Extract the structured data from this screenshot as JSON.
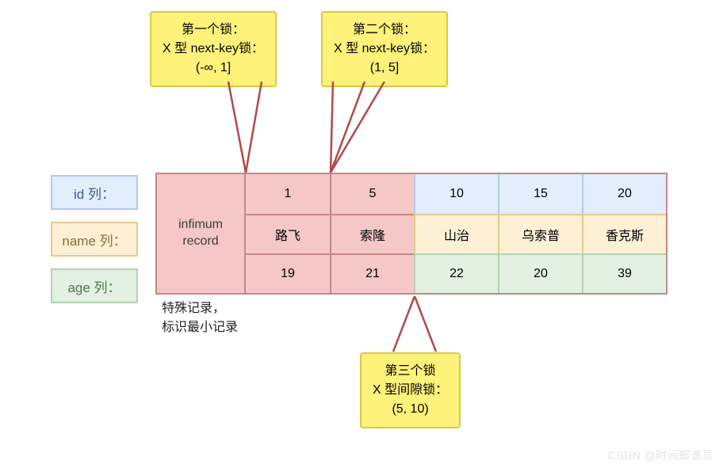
{
  "callouts": {
    "c1": {
      "l1": "第一个锁：",
      "l2": "X 型 next-key锁：",
      "l3": "(-∞, 1]"
    },
    "c2": {
      "l1": "第二个锁：",
      "l2": "X 型 next-key锁：",
      "l3": "(1, 5]"
    },
    "c3": {
      "l1": "第三个锁",
      "l2": "X 型间隙锁：",
      "l3": "(5, 10)"
    }
  },
  "labels": {
    "id": "id 列：",
    "name": "name 列：",
    "age": "age 列："
  },
  "infimum": "infimum\nrecord",
  "note": {
    "l1": "特殊记录，",
    "l2": "标识最小记录"
  },
  "table": {
    "ids": [
      "1",
      "5",
      "10",
      "15",
      "20"
    ],
    "names": [
      "路飞",
      "索隆",
      "山治",
      "乌索普",
      "香克斯"
    ],
    "ages": [
      "19",
      "21",
      "22",
      "20",
      "39"
    ]
  },
  "watermark": "CSDN @时间邮递员",
  "chart_data": {
    "type": "table",
    "title": "MySQL InnoDB 加锁示意 (锁范围图示)",
    "columns": [
      "id",
      "name",
      "age"
    ],
    "rows": [
      {
        "id": 1,
        "name": "路飞",
        "age": 19
      },
      {
        "id": 5,
        "name": "索隆",
        "age": 21
      },
      {
        "id": 10,
        "name": "山治",
        "age": 22
      },
      {
        "id": 15,
        "name": "乌索普",
        "age": 20
      },
      {
        "id": 20,
        "name": "香克斯",
        "age": 39
      }
    ],
    "infimum_record": "infimum record — 特殊记录, 标识最小记录",
    "locks": [
      {
        "order": 1,
        "type": "X next-key lock",
        "range": "(-∞, 1]",
        "on_boundary_between": [
          "infimum",
          1
        ]
      },
      {
        "order": 2,
        "type": "X next-key lock",
        "range": "(1, 5]",
        "on_boundary_between": [
          1,
          5
        ]
      },
      {
        "order": 3,
        "type": "X gap lock",
        "range": "(5, 10)",
        "on_boundary_between": [
          5,
          10
        ]
      }
    ],
    "highlighted_locked_records": [
      1,
      5
    ]
  }
}
